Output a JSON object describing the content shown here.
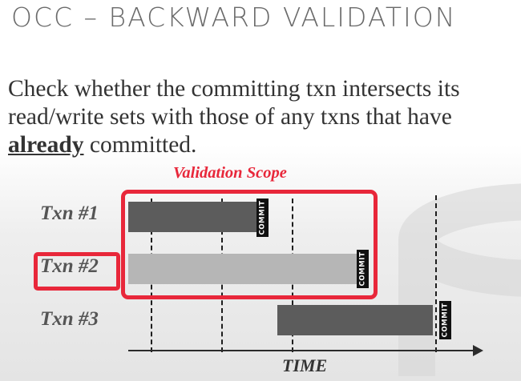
{
  "slide": {
    "title": "OCC – BACKWARD VALIDATION",
    "body_before": "Check whether the committing txn intersects its read/write sets with those of any txns that have ",
    "body_emphasis": "already",
    "body_after": " committed."
  },
  "diagram": {
    "scope_label": "Validation Scope",
    "axis_label": "TIME",
    "commit_label": "COMMIT",
    "transactions": [
      {
        "label": "Txn #1",
        "shade": "dark"
      },
      {
        "label": "Txn #2",
        "shade": "light",
        "highlighted": true
      },
      {
        "label": "Txn #3",
        "shade": "dark"
      }
    ],
    "colors": {
      "accent": "#e8273a",
      "dark_bar": "#5c5c5c",
      "light_bar": "#b6b6b6",
      "commit": "#111111"
    }
  }
}
